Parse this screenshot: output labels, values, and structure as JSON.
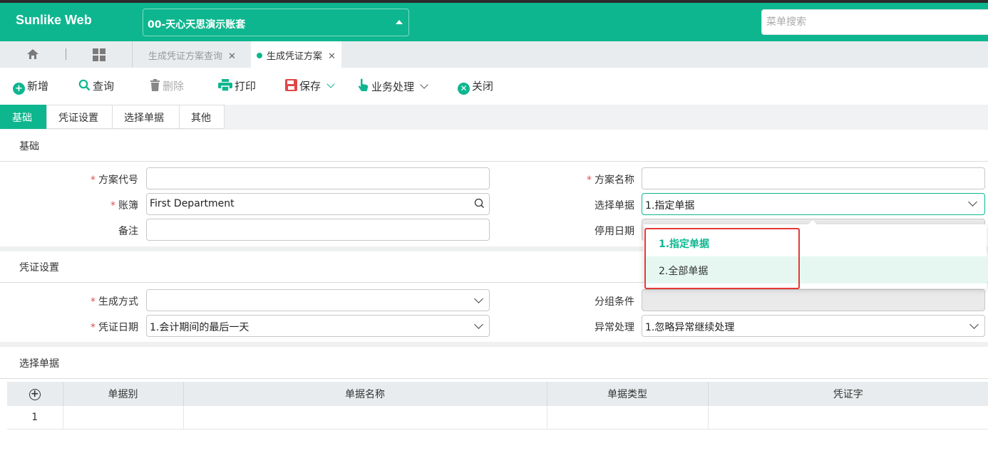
{
  "app": {
    "brand": "Sunlike Web",
    "account": "00-天心天思演示账套",
    "menu_search_placeholder": "菜单搜索"
  },
  "tabs": [
    {
      "label": "生成凭证方案查询",
      "active": false
    },
    {
      "label": "生成凭证方案",
      "active": true
    }
  ],
  "toolbar": {
    "new": "新增",
    "query": "查询",
    "delete": "删除",
    "print": "打印",
    "save": "保存",
    "business": "业务处理",
    "close": "关闭"
  },
  "subtabs": [
    "基础",
    "凭证设置",
    "选择单据",
    "其他"
  ],
  "basic": {
    "title": "基础",
    "scheme_code_label": "方案代号",
    "scheme_code_value": "",
    "scheme_name_label": "方案名称",
    "scheme_name_value": "",
    "ledger_label": "账簿",
    "ledger_value": "First Department",
    "select_docs_label": "选择单据",
    "select_docs_value": "1.指定单据",
    "remark_label": "备注",
    "remark_value": "",
    "disable_date_label": "停用日期"
  },
  "dropdown": {
    "options": [
      "1.指定单据",
      "2.全部单据"
    ],
    "selected": "1.指定单据"
  },
  "voucher": {
    "title": "凭证设置",
    "gen_mode_label": "生成方式",
    "gen_mode_value": "",
    "group_label": "分组条件",
    "date_label": "凭证日期",
    "date_value": "1.会计期间的最后一天",
    "exception_label": "异常处理",
    "exception_value": "1.忽略异常继续处理"
  },
  "docs": {
    "title": "选择单据",
    "columns": [
      "单据别",
      "单据名称",
      "单据类型",
      "凭证字"
    ],
    "rows": [
      {
        "no": "1",
        "cells": [
          "",
          "",
          "",
          ""
        ]
      }
    ]
  },
  "colors": {
    "accent": "#0eb68f",
    "highlight_box": "#e53935",
    "required": "#e05050"
  }
}
